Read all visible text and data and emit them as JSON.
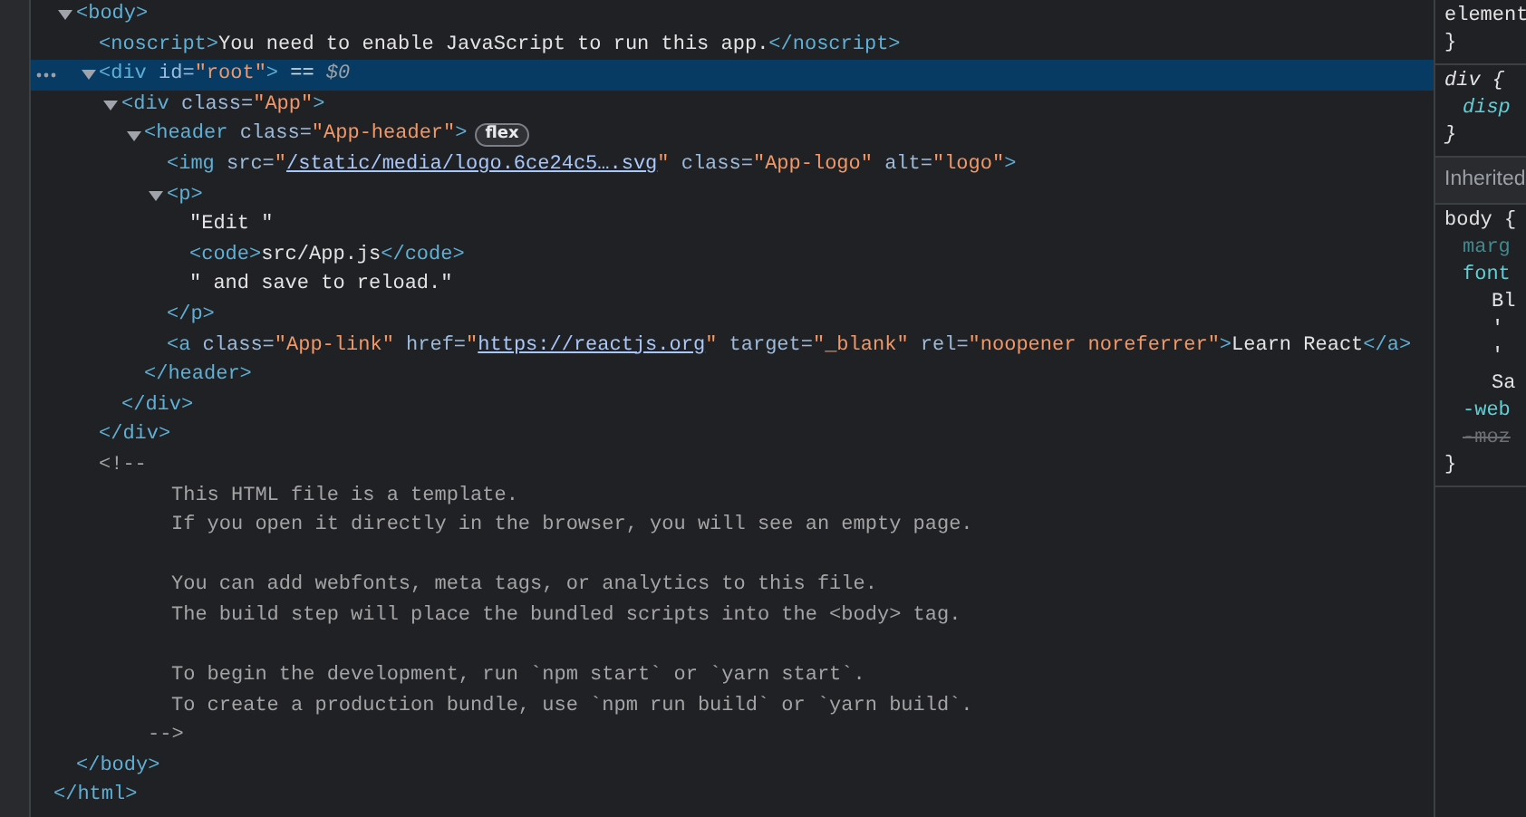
{
  "elements_tree": [
    {
      "kind": "element",
      "children": [
        {
          "kind": "element",
          "line": [
            {
              "kind": "tag",
              "text": "<body>"
            }
          ],
          "expanded": true,
          "selected": false,
          "children": [
            {
              "kind": "element",
              "line": [
                {
                  "kind": "tag",
                  "text": "<noscript>"
                },
                {
                  "kind": "text",
                  "text": "You need to enable JavaScript to run this app."
                },
                {
                  "kind": "tag",
                  "text": "</noscript>"
                }
              ],
              "selected": false
            },
            {
              "kind": "element",
              "line": [
                {
                  "kind": "tag",
                  "text": "<div"
                },
                {
                  "kind": "attr-name",
                  "text": "id="
                },
                {
                  "kind": "attr-value",
                  "text": "\"root\""
                },
                {
                  "kind": "tag",
                  "text": ">"
                },
                {
                  "kind": "marker",
                  "text": "=="
                },
                {
                  "kind": "reference",
                  "text": "$0"
                }
              ],
              "expanded": true,
              "selected": true,
              "children": [
                {
                  "kind": "element",
                  "line": [
                    {
                      "kind": "tag",
                      "text": "<div"
                    },
                    {
                      "kind": "attr-name",
                      "text": "class="
                    },
                    {
                      "kind": "attr-value",
                      "text": "\"App\""
                    },
                    {
                      "kind": "tag",
                      "text": ">"
                    }
                  ],
                  "expanded": true,
                  "selected": false,
                  "children": [
                    {
                      "kind": "element",
                      "line": [
                        {
                          "kind": "tag",
                          "text": "<header"
                        },
                        {
                          "kind": "attr-name",
                          "text": "class="
                        },
                        {
                          "kind": "attr-value",
                          "text": "\"App-header\""
                        },
                        {
                          "kind": "tag",
                          "text": ">"
                        },
                        {
                          "kind": "badge",
                          "text": "flex"
                        }
                      ],
                      "expanded": true,
                      "selected": false,
                      "children": [
                        {
                          "kind": "element",
                          "line": [
                            {
                              "kind": "tag",
                              "text": "<img"
                            },
                            {
                              "kind": "attr-name",
                              "text": "src="
                            },
                            {
                              "kind": "attr-value",
                              "text": "\""
                            },
                            {
                              "kind": "link",
                              "text": "/static/media/logo.6ce24c5….svg"
                            },
                            {
                              "kind": "attr-value",
                              "text": "\""
                            },
                            {
                              "kind": "attr-name",
                              "text": "class="
                            },
                            {
                              "kind": "attr-value",
                              "text": "\"App-logo\""
                            },
                            {
                              "kind": "attr-name",
                              "text": "alt="
                            },
                            {
                              "kind": "attr-value",
                              "text": "\"logo\""
                            },
                            {
                              "kind": "tag",
                              "text": ">"
                            }
                          ],
                          "selected": false
                        },
                        {
                          "kind": "element",
                          "line": [
                            {
                              "kind": "tag",
                              "text": "<p>"
                            }
                          ],
                          "expanded": true,
                          "selected": false,
                          "children": [
                            {
                              "kind": "element",
                              "line": [
                                {
                                  "kind": "text",
                                  "text": "\"Edit \""
                                }
                              ],
                              "selected": false
                            },
                            {
                              "kind": "element",
                              "line": [
                                {
                                  "kind": "tag",
                                  "text": "<code>"
                                },
                                {
                                  "kind": "text",
                                  "text": "src/App.js"
                                },
                                {
                                  "kind": "tag",
                                  "text": "</code>"
                                }
                              ],
                              "selected": false
                            },
                            {
                              "kind": "element",
                              "line": [
                                {
                                  "kind": "text",
                                  "text": "\" and save to reload.\""
                                }
                              ],
                              "selected": false
                            }
                          ],
                          "close": [
                            {
                              "kind": "tag",
                              "text": "</p>"
                            }
                          ]
                        },
                        {
                          "kind": "element",
                          "line": [
                            {
                              "kind": "tag",
                              "text": "<a"
                            },
                            {
                              "kind": "attr-name",
                              "text": "class="
                            },
                            {
                              "kind": "attr-value",
                              "text": "\"App-link\""
                            },
                            {
                              "kind": "attr-name",
                              "text": "href="
                            },
                            {
                              "kind": "attr-value",
                              "text": "\""
                            },
                            {
                              "kind": "link",
                              "text": "https://reactjs.org"
                            },
                            {
                              "kind": "attr-value",
                              "text": "\""
                            },
                            {
                              "kind": "attr-name",
                              "text": "target="
                            },
                            {
                              "kind": "attr-value",
                              "text": "\"_blank\""
                            },
                            {
                              "kind": "attr-name",
                              "text": "rel="
                            },
                            {
                              "kind": "attr-value",
                              "text": "\"noopener noreferrer\""
                            },
                            {
                              "kind": "tag",
                              "text": ">"
                            },
                            {
                              "kind": "text",
                              "text": "Learn React"
                            },
                            {
                              "kind": "tag",
                              "text": "</a>"
                            }
                          ],
                          "selected": false
                        }
                      ],
                      "close": [
                        {
                          "kind": "tag",
                          "text": "</header>"
                        }
                      ]
                    }
                  ],
                  "close": [
                    {
                      "kind": "tag",
                      "text": "</div>"
                    }
                  ]
                }
              ],
              "close": [
                {
                  "kind": "tag",
                  "text": "</div>"
                }
              ]
            },
            {
              "kind": "comment",
              "line": [
                {
                  "kind": "comment",
                  "text": "<!--"
                }
              ],
              "selected": false,
              "paragraphs": [
                [
                  "This HTML file is a template.",
                  "If you open it directly in the browser, you will see an empty page."
                ],
                [
                  "You can add webfonts, meta tags, or analytics to this file.",
                  "The build step will place the bundled scripts into the <body> tag."
                ],
                [
                  "To begin the development, run `npm start` or `yarn start`.",
                  "To create a production bundle, use `npm run build` or `yarn build`."
                ]
              ],
              "close": [
                {
                  "kind": "comment",
                  "text": "-->"
                }
              ]
            }
          ],
          "close": [
            {
              "kind": "tag",
              "text": "</body>"
            }
          ]
        }
      ],
      "close": [
        {
          "kind": "tag",
          "text": "</html>"
        }
      ]
    }
  ],
  "styles_pane": {
    "sections": [
      {
        "kind": "rule",
        "selector": "element",
        "user_agent": false,
        "close": "}"
      },
      {
        "kind": "rule",
        "selector": "div {",
        "user_agent": true,
        "properties": [
          {
            "kind": "property",
            "text": "disp",
            "inactive": false,
            "overridden": false
          }
        ],
        "close": "}"
      },
      {
        "kind": "header",
        "text": "Inherited"
      },
      {
        "kind": "rule",
        "selector": "body {",
        "user_agent": false,
        "properties": [
          {
            "kind": "property",
            "text": "marg",
            "inactive": true,
            "overridden": false
          },
          {
            "kind": "property",
            "text": "font",
            "inactive": false,
            "overridden": false
          },
          {
            "kind": "value",
            "text": "Bl"
          },
          {
            "kind": "value",
            "text": "'"
          },
          {
            "kind": "value",
            "text": "'"
          },
          {
            "kind": "value",
            "text": "Sa"
          },
          {
            "kind": "property",
            "text": "-web",
            "inactive": false,
            "overridden": false
          },
          {
            "kind": "property",
            "text": "-moz",
            "inactive": false,
            "overridden": true
          }
        ],
        "close": "}"
      }
    ]
  }
}
